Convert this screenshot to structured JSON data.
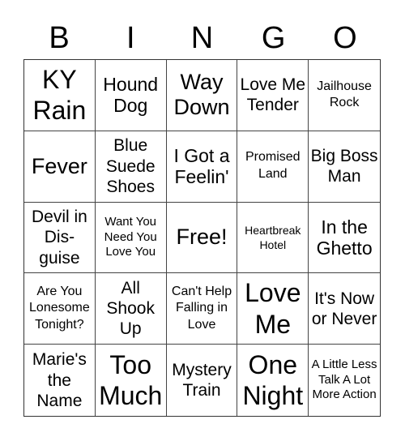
{
  "header": {
    "letters": [
      "B",
      "I",
      "N",
      "G",
      "O"
    ]
  },
  "grid": {
    "rows": [
      [
        "KY Rain",
        "Hound Dog",
        "Way Down",
        "Love Me Tender",
        "Jailhouse Rock"
      ],
      [
        "Fever",
        "Blue Suede Shoes",
        "I Got a Feelin'",
        "Promised Land",
        "Big Boss Man"
      ],
      [
        "Devil in Dis-guise",
        "Want You Need You Love You",
        "Free!",
        "Heartbreak Hotel",
        "In the Ghetto"
      ],
      [
        "Are You Lonesome Tonight?",
        "All Shook Up",
        "Can't Help Falling in Love",
        "Love Me",
        "It's Now or Never"
      ],
      [
        "Marie's the Name",
        "Too Much",
        "Mystery Train",
        "One Night",
        "A Little Less Talk A Lot More Action"
      ]
    ],
    "free_space": "Free!"
  }
}
